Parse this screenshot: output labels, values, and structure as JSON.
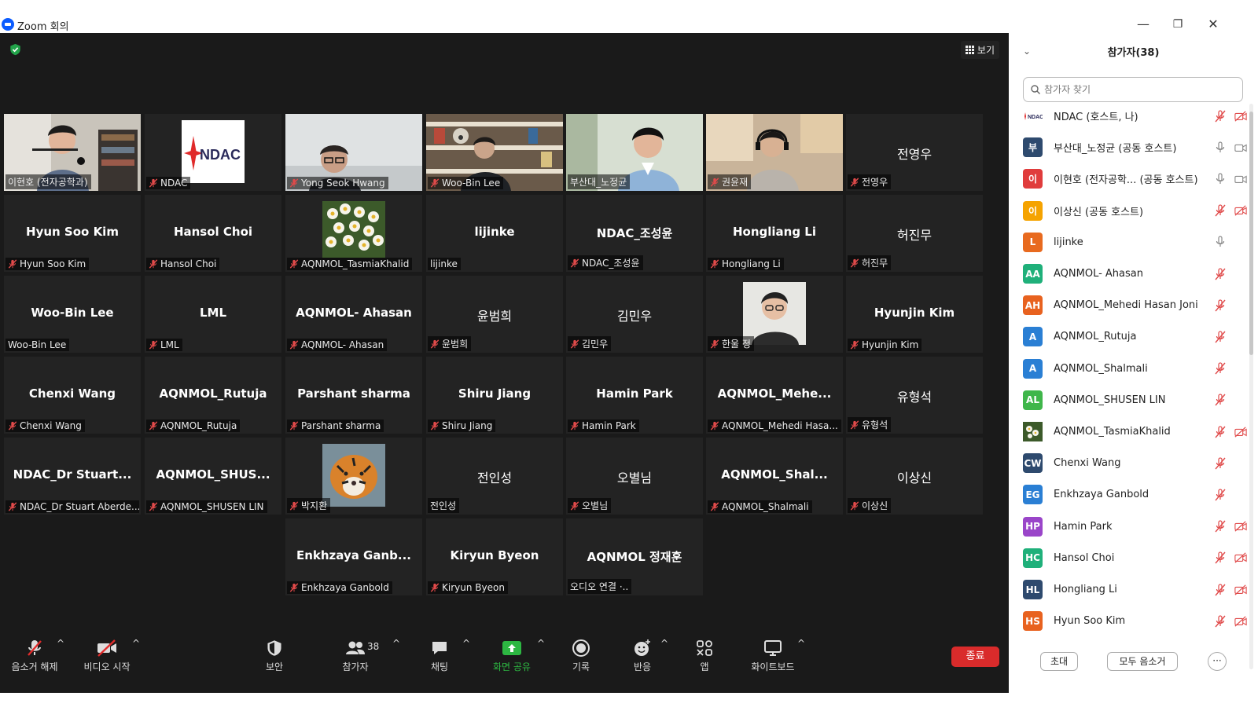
{
  "window": {
    "title": "Zoom 회의",
    "minimize": "—",
    "restore": "❐",
    "close": "✕"
  },
  "meeting": {
    "view_label": "보기",
    "tiles": [
      {
        "row": 0,
        "col": 0,
        "tag": "이현호 (전자공학과)",
        "display": "",
        "muted": false,
        "photo": "man-office",
        "active": true
      },
      {
        "row": 0,
        "col": 1,
        "tag": "NDAC",
        "display": "",
        "muted": true,
        "photo": "ndac-logo"
      },
      {
        "row": 0,
        "col": 2,
        "tag": "Yong Seok Hwang",
        "display": "",
        "muted": true,
        "photo": "man-glasses"
      },
      {
        "row": 0,
        "col": 3,
        "tag": "Woo-Bin Lee",
        "display": "",
        "muted": true,
        "photo": "man-shelves"
      },
      {
        "row": 0,
        "col": 4,
        "tag": "부산대_노정균",
        "display": "",
        "muted": false,
        "photo": "man-green"
      },
      {
        "row": 0,
        "col": 5,
        "tag": "권윤재",
        "display": "",
        "muted": true,
        "photo": "man-headset"
      },
      {
        "row": 0,
        "col": 6,
        "tag": "전영우",
        "display": "전영우",
        "muted": true
      },
      {
        "row": 1,
        "col": 0,
        "tag": "Hyun Soo Kim",
        "display": "Hyun Soo Kim",
        "muted": true
      },
      {
        "row": 1,
        "col": 1,
        "tag": "Hansol Choi",
        "display": "Hansol Choi",
        "muted": true
      },
      {
        "row": 1,
        "col": 2,
        "tag": "AQNMOL_TasmiaKhalid",
        "display": "",
        "muted": true,
        "photo": "flowers"
      },
      {
        "row": 1,
        "col": 3,
        "tag": "lijinke",
        "display": "lijinke",
        "muted": false
      },
      {
        "row": 1,
        "col": 4,
        "tag": "NDAC_조성윤",
        "display": "NDAC_조성윤",
        "muted": true
      },
      {
        "row": 1,
        "col": 5,
        "tag": "Hongliang Li",
        "display": "Hongliang Li",
        "muted": true
      },
      {
        "row": 1,
        "col": 6,
        "tag": "허진무",
        "display": "허진무",
        "muted": true
      },
      {
        "row": 2,
        "col": 0,
        "tag": "Woo-Bin Lee",
        "display": "Woo-Bin Lee",
        "muted": false
      },
      {
        "row": 2,
        "col": 1,
        "tag": "LML",
        "display": "LML",
        "muted": true
      },
      {
        "row": 2,
        "col": 2,
        "tag": "AQNMOL- Ahasan",
        "display": "AQNMOL- Ahasan",
        "muted": true
      },
      {
        "row": 2,
        "col": 3,
        "tag": "윤범희",
        "display": "윤범희",
        "muted": true
      },
      {
        "row": 2,
        "col": 4,
        "tag": "김민우",
        "display": "김민우",
        "muted": true
      },
      {
        "row": 2,
        "col": 5,
        "tag": "한울 정",
        "display": "",
        "muted": true,
        "photo": "profile-man"
      },
      {
        "row": 2,
        "col": 6,
        "tag": "Hyunjin Kim",
        "display": "Hyunjin Kim",
        "muted": true
      },
      {
        "row": 3,
        "col": 0,
        "tag": "Chenxi Wang",
        "display": "Chenxi Wang",
        "muted": true
      },
      {
        "row": 3,
        "col": 1,
        "tag": "AQNMOL_Rutuja",
        "display": "AQNMOL_Rutuja",
        "muted": true
      },
      {
        "row": 3,
        "col": 2,
        "tag": "Parshant sharma",
        "display": "Parshant sharma",
        "muted": true
      },
      {
        "row": 3,
        "col": 3,
        "tag": "Shiru Jiang",
        "display": "Shiru Jiang",
        "muted": true
      },
      {
        "row": 3,
        "col": 4,
        "tag": "Hamin Park",
        "display": "Hamin Park",
        "muted": true
      },
      {
        "row": 3,
        "col": 5,
        "tag": "AQNMOL_Mehedi Hasa...",
        "display": "AQNMOL_Mehe...",
        "muted": true
      },
      {
        "row": 3,
        "col": 6,
        "tag": "유형석",
        "display": "유형석",
        "muted": true
      },
      {
        "row": 4,
        "col": 0,
        "tag": "NDAC_Dr Stuart Aberde...",
        "display": "NDAC_Dr  Stuart...",
        "muted": true
      },
      {
        "row": 4,
        "col": 1,
        "tag": "AQNMOL_SHUSEN LIN",
        "display": "AQNMOL_SHUS...",
        "muted": true
      },
      {
        "row": 4,
        "col": 2,
        "tag": "박지환",
        "display": "",
        "muted": true,
        "photo": "tiger"
      },
      {
        "row": 4,
        "col": 3,
        "tag": "전인성",
        "display": "전인성",
        "muted": false
      },
      {
        "row": 4,
        "col": 4,
        "tag": "오별님",
        "display": "오별님",
        "muted": true
      },
      {
        "row": 4,
        "col": 5,
        "tag": "AQNMOL_Shalmali",
        "display": "AQNMOL_Shal...",
        "muted": true
      },
      {
        "row": 4,
        "col": 6,
        "tag": "이상신",
        "display": "이상신",
        "muted": true
      },
      {
        "row": 5,
        "col": 2,
        "tag": "Enkhzaya Ganbold",
        "display": "Enkhzaya  Ganb...",
        "muted": true
      },
      {
        "row": 5,
        "col": 3,
        "tag": "Kiryun Byeon",
        "display": "Kiryun Byeon",
        "muted": true
      },
      {
        "row": 5,
        "col": 4,
        "tag": "오디오 연결 ·..",
        "display": "AQNMOL 정재훈",
        "muted": false
      }
    ]
  },
  "toolbar": {
    "unmute": "음소거 해제",
    "start_video": "비디오 시작",
    "security": "보안",
    "participants": "참가자",
    "participant_count": "38",
    "chat": "채팅",
    "share_screen": "화면 공유",
    "record": "기록",
    "reactions": "반응",
    "apps": "앱",
    "whiteboard": "화이트보드",
    "end": "종료",
    "caret": "^",
    "colors": {
      "share": "#2db742",
      "end": "#d92b2b"
    }
  },
  "panel": {
    "collapse_glyph": "⌄",
    "title": "참가자(38)",
    "search_placeholder": "참가자 찾기",
    "invite": "초대",
    "mute_all": "모두 음소거",
    "more": "···",
    "participants": [
      {
        "name": "NDAC (호스트, 나)",
        "avatar": "logo",
        "initials": "",
        "color": "#ffffff",
        "mic": "muted",
        "video": "off"
      },
      {
        "name": "부산대_노정균 (공동 호스트)",
        "avatar": "letter",
        "initials": "부",
        "color": "#2e4a6e",
        "mic": "on",
        "video": "on"
      },
      {
        "name": "이현호 (전자공학... (공동 호스트)",
        "avatar": "letter",
        "initials": "이",
        "color": "#e03c3c",
        "mic": "on",
        "video": "on"
      },
      {
        "name": "이상신 (공동 호스트)",
        "avatar": "letter",
        "initials": "이",
        "color": "#f5a300",
        "mic": "muted",
        "video": "off"
      },
      {
        "name": "lijinke",
        "avatar": "letter",
        "initials": "L",
        "color": "#e86a1f",
        "mic": "on",
        "video": "none"
      },
      {
        "name": "AQNMOL- Ahasan",
        "avatar": "letter",
        "initials": "AA",
        "color": "#1fb07a",
        "mic": "muted",
        "video": "none"
      },
      {
        "name": "AQNMOL_Mehedi Hasan Joni",
        "avatar": "letter",
        "initials": "AH",
        "color": "#e8621f",
        "mic": "muted",
        "video": "none"
      },
      {
        "name": "AQNMOL_Rutuja",
        "avatar": "letter",
        "initials": "A",
        "color": "#2a7fd4",
        "mic": "muted",
        "video": "none"
      },
      {
        "name": "AQNMOL_Shalmali",
        "avatar": "letter",
        "initials": "A",
        "color": "#2a7fd4",
        "mic": "muted",
        "video": "none"
      },
      {
        "name": "AQNMOL_SHUSEN LIN",
        "avatar": "letter",
        "initials": "AL",
        "color": "#3fb64a",
        "mic": "muted",
        "video": "none"
      },
      {
        "name": "AQNMOL_TasmiaKhalid",
        "avatar": "flower",
        "initials": "",
        "color": "#d8d8d8",
        "mic": "muted",
        "video": "off"
      },
      {
        "name": "Chenxi Wang",
        "avatar": "letter",
        "initials": "CW",
        "color": "#2e4a6e",
        "mic": "muted",
        "video": "none"
      },
      {
        "name": "Enkhzaya Ganbold",
        "avatar": "letter",
        "initials": "EG",
        "color": "#2a7fd4",
        "mic": "muted",
        "video": "none"
      },
      {
        "name": "Hamin Park",
        "avatar": "letter",
        "initials": "HP",
        "color": "#9a45c9",
        "mic": "muted",
        "video": "off"
      },
      {
        "name": "Hansol Choi",
        "avatar": "letter",
        "initials": "HC",
        "color": "#1fb07a",
        "mic": "muted",
        "video": "off"
      },
      {
        "name": "Hongliang Li",
        "avatar": "letter",
        "initials": "HL",
        "color": "#2e4a6e",
        "mic": "muted",
        "video": "off"
      },
      {
        "name": "Hyun Soo Kim",
        "avatar": "letter",
        "initials": "HS",
        "color": "#e8621f",
        "mic": "muted",
        "video": "off"
      }
    ]
  }
}
